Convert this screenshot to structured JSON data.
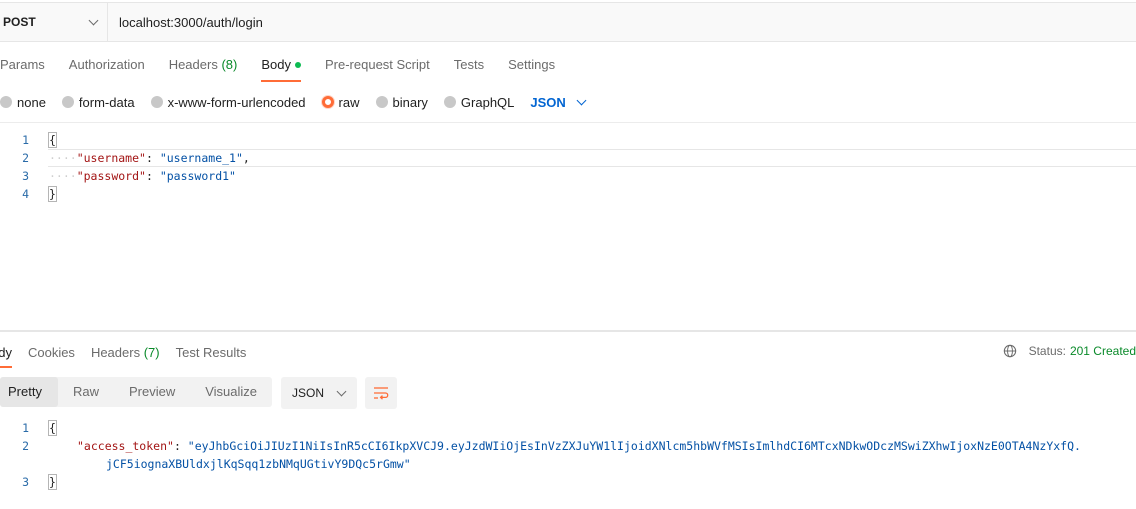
{
  "request": {
    "method": "POST",
    "url": "localhost:3000/auth/login"
  },
  "request_tabs": [
    {
      "label": "Params"
    },
    {
      "label": "Authorization"
    },
    {
      "label": "Headers",
      "count": "(8)"
    },
    {
      "label": "Body",
      "active": true
    },
    {
      "label": "Pre-request Script"
    },
    {
      "label": "Tests"
    },
    {
      "label": "Settings"
    }
  ],
  "body_types": {
    "options": [
      "none",
      "form-data",
      "x-www-form-urlencoded",
      "raw",
      "binary",
      "GraphQL"
    ],
    "selected": "raw",
    "language": "JSON"
  },
  "request_body": {
    "line_numbers": [
      "1",
      "2",
      "3",
      "4"
    ],
    "open_brace": "{",
    "close_brace": "}",
    "indent_dots": "····",
    "fields": [
      {
        "key": "\"username\"",
        "value": "\"username_1\"",
        "trailing": ","
      },
      {
        "key": "\"password\"",
        "value": "\"password1\"",
        "trailing": ""
      }
    ]
  },
  "response_tabs": [
    {
      "label": "Body",
      "visible_text": "ody",
      "active": true
    },
    {
      "label": "Cookies"
    },
    {
      "label": "Headers",
      "count": "(7)"
    },
    {
      "label": "Test Results"
    }
  ],
  "response_status": {
    "label": "Status:",
    "value": "201 Created",
    "color": "#0a8a2a"
  },
  "response_toolbar": {
    "views": [
      "Pretty",
      "Raw",
      "Preview",
      "Visualize"
    ],
    "active_view": "Pretty",
    "format": "JSON",
    "wrap_icon": "wrap-lines-icon"
  },
  "response_body": {
    "line_numbers": [
      "1",
      "2",
      "3"
    ],
    "open_brace": "{",
    "close_brace": "}",
    "key": "\"access_token\"",
    "value_line1": "\"eyJhbGciOiJIUzI1NiIsInR5cCI6IkpXVCJ9.eyJzdWIiOjEsInVzZXJuYW1lIjoidXNlcm5hbWVfMSIsImlhdCI6MTcxNDkwODczMSwiZXhwIjoxNzE0OTA4NzYxfQ.",
    "value_line2": "jCF5iognaXBUldxjlKqSqq1zbNMqUGtivY9DQc5rGmw\""
  },
  "colors": {
    "accent": "#ff6c37",
    "link_blue": "#0265d2",
    "count_green": "#0a8a2a"
  }
}
